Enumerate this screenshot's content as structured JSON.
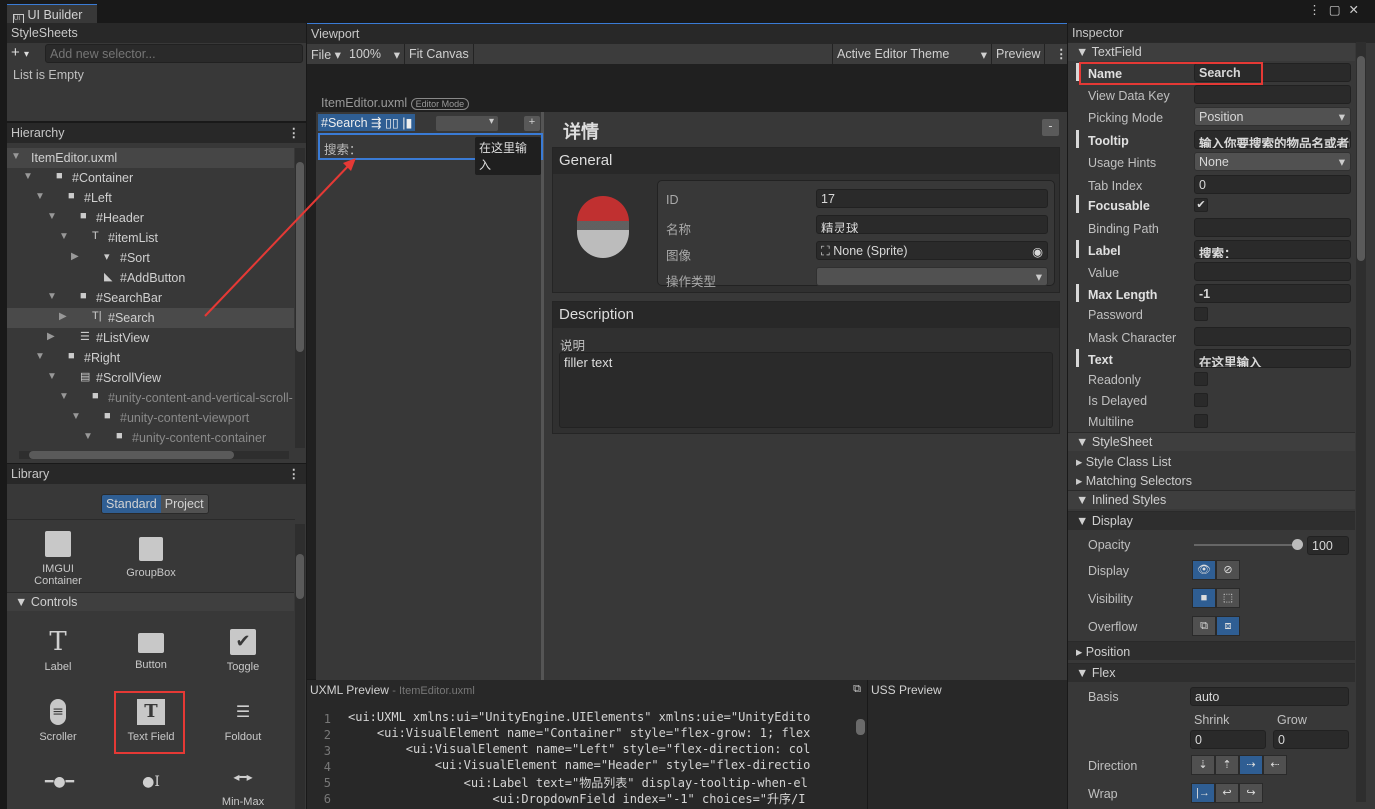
{
  "window": {
    "tab": "UI Builder",
    "icon": "ui-builder-icon"
  },
  "stylesheets": {
    "title": "StyleSheets",
    "add_label": "+",
    "selector_placeholder": "Add new selector...",
    "empty": "List is Empty"
  },
  "hierarchy": {
    "title": "Hierarchy",
    "items": [
      {
        "label": "ItemEditor.uxml",
        "depth": 0,
        "arrow": "open",
        "icon": "",
        "style": "root"
      },
      {
        "label": "#Container",
        "depth": 1,
        "arrow": "open",
        "icon": "element"
      },
      {
        "label": "#Left",
        "depth": 2,
        "arrow": "open",
        "icon": "element"
      },
      {
        "label": "#Header",
        "depth": 3,
        "arrow": "open",
        "icon": "element"
      },
      {
        "label": "#itemList",
        "depth": 4,
        "arrow": "open",
        "icon": "label"
      },
      {
        "label": "#Sort",
        "depth": 5,
        "arrow": "closed",
        "icon": "dropdown"
      },
      {
        "label": "#AddButton",
        "depth": 5,
        "arrow": "",
        "icon": "button"
      },
      {
        "label": "#SearchBar",
        "depth": 3,
        "arrow": "open",
        "icon": "element"
      },
      {
        "label": "#Search",
        "depth": 4,
        "arrow": "closed",
        "icon": "textfield",
        "selected": true
      },
      {
        "label": "#ListView",
        "depth": 3,
        "arrow": "closed",
        "icon": "listview"
      },
      {
        "label": "#Right",
        "depth": 2,
        "arrow": "open",
        "icon": "element"
      },
      {
        "label": "#ScrollView",
        "depth": 3,
        "arrow": "open",
        "icon": "scrollview"
      },
      {
        "label": "#unity-content-and-vertical-scroll-",
        "depth": 4,
        "arrow": "open",
        "icon": "element",
        "dim": true
      },
      {
        "label": "#unity-content-viewport",
        "depth": 5,
        "arrow": "open",
        "icon": "element",
        "dim": true
      },
      {
        "label": "#unity-content-container",
        "depth": 6,
        "arrow": "open",
        "icon": "element",
        "dim": true
      }
    ]
  },
  "library": {
    "title": "Library",
    "tabs": [
      "Standard",
      "Project"
    ],
    "active_tab": "Standard",
    "containers": [
      {
        "label": "IMGUI Container",
        "icon": "square-icon"
      },
      {
        "label": "GroupBox",
        "icon": "square-icon"
      }
    ],
    "controls_title": "Controls",
    "controls": [
      {
        "label": "Label",
        "icon": "T"
      },
      {
        "label": "Button",
        "icon": "button-icon"
      },
      {
        "label": "Toggle",
        "icon": "✔"
      },
      {
        "label": "Scroller",
        "icon": "≡"
      },
      {
        "label": "Text Field",
        "icon": "textfield-icon"
      },
      {
        "label": "Foldout",
        "icon": "foldout-icon"
      },
      {
        "label": "",
        "icon": "slider-icon"
      },
      {
        "label": "",
        "icon": "slider-int-icon"
      },
      {
        "label": "Min-Max",
        "icon": "minmax-icon"
      }
    ]
  },
  "viewport": {
    "title": "Viewport",
    "file": "File",
    "zoom": "100%",
    "fit": "Fit Canvas",
    "theme": "Active Editor Theme",
    "preview": "Preview",
    "doc_name": "ItemEditor.uxml",
    "mode_badge": "Editor Mode",
    "selected_name": "#Search",
    "search_label": "搜索：",
    "search_value": "在这里输入",
    "add": "+",
    "detail_title": "详情",
    "collapse": "-",
    "general": {
      "title": "General",
      "fields": [
        {
          "label": "ID",
          "value": "17"
        },
        {
          "label": "名称",
          "value": "精灵球"
        },
        {
          "label": "图像",
          "value": "None (Sprite)"
        },
        {
          "label": "操作类型",
          "value": ""
        }
      ]
    },
    "description": {
      "title": "Description",
      "label": "说明",
      "value": "filler text"
    }
  },
  "uxml_preview": {
    "title": "UXML Preview",
    "file": "- ItemEditor.uxml",
    "lines": [
      "<ui:UXML xmlns:ui=\"UnityEngine.UIElements\" xmlns:uie=\"UnityEdito",
      "    <ui:VisualElement name=\"Container\" style=\"flex-grow: 1; flex",
      "        <ui:VisualElement name=\"Left\" style=\"flex-direction: col",
      "            <ui:VisualElement name=\"Header\" style=\"flex-directio",
      "                <ui:Label text=\"物品列表\" display-tooltip-when-el",
      "                    <ui:DropdownField index=\"-1\" choices=\"升序/I"
    ]
  },
  "uss_preview": {
    "title": "USS Preview"
  },
  "inspector": {
    "title": "Inspector",
    "section": "TextField",
    "rows": [
      {
        "label": "Name",
        "value": "Search",
        "type": "text",
        "bold": true
      },
      {
        "label": "View Data Key",
        "value": "",
        "type": "text"
      },
      {
        "label": "Picking Mode",
        "value": "Position",
        "type": "drop"
      },
      {
        "label": "Tooltip",
        "value": "输入你要搜索的物品名或者I",
        "type": "text",
        "bold": true
      },
      {
        "label": "Usage Hints",
        "value": "None",
        "type": "drop"
      },
      {
        "label": "Tab Index",
        "value": "0",
        "type": "text"
      },
      {
        "label": "Focusable",
        "value": true,
        "type": "check",
        "bold": true
      },
      {
        "label": "Binding Path",
        "value": "",
        "type": "text"
      },
      {
        "label": "Label",
        "value": "搜索：",
        "type": "text",
        "bold": true
      },
      {
        "label": "Value",
        "value": "",
        "type": "text"
      },
      {
        "label": "Max Length",
        "value": "-1",
        "type": "text",
        "bold": true
      },
      {
        "label": "Password",
        "value": false,
        "type": "check"
      },
      {
        "label": "Mask Character",
        "value": "",
        "type": "text"
      },
      {
        "label": "Text",
        "value": "在这里输入",
        "type": "text",
        "bold": true
      },
      {
        "label": "Readonly",
        "value": false,
        "type": "check"
      },
      {
        "label": "Is Delayed",
        "value": false,
        "type": "check"
      },
      {
        "label": "Multiline",
        "value": false,
        "type": "check"
      }
    ],
    "stylesheet": "StyleSheet",
    "style_class_list": "Style Class List",
    "matching_selectors": "Matching Selectors",
    "inlined_styles": "Inlined Styles",
    "display_section": "Display",
    "opacity_label": "Opacity",
    "opacity": 100,
    "display_label": "Display",
    "visibility_label": "Visibility",
    "overflow_label": "Overflow",
    "position_section": "Position",
    "flex_section": "Flex",
    "basis_label": "Basis",
    "basis": "auto",
    "shrink_label": "Shrink",
    "shrink": "0",
    "grow_label": "Grow",
    "grow": "0",
    "direction_label": "Direction",
    "direction": "row",
    "wrap_label": "Wrap",
    "wrap": "nowrap"
  },
  "colors": {
    "accent": "#2f5e93",
    "highlight": "#e53935",
    "selection": "#4a90d9"
  }
}
